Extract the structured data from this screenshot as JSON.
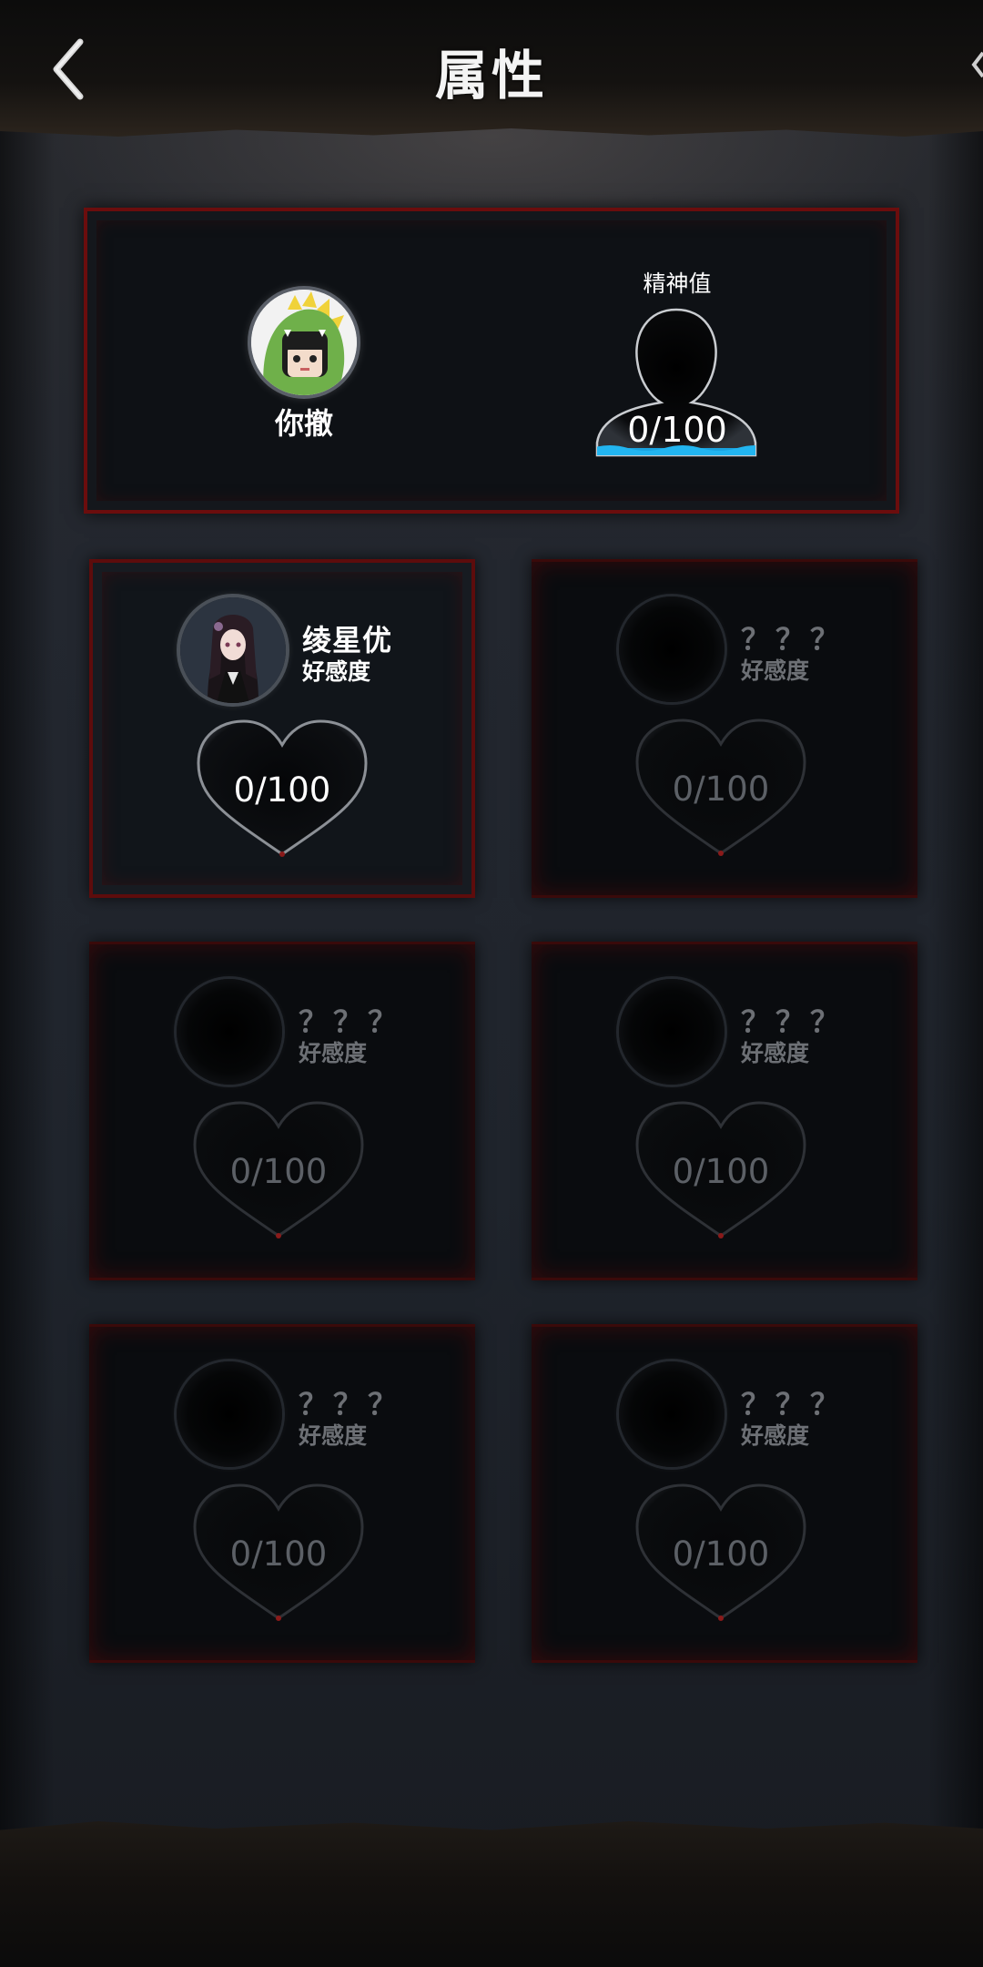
{
  "header": {
    "title": "属性",
    "back_icon": "chevron-left-icon"
  },
  "player": {
    "name": "你撤",
    "avatar_icon": "dinosaur-hood-avatar",
    "sanity": {
      "label": "精神值",
      "value_text": "0/100",
      "value": 0,
      "max": 100,
      "icon": "person-silhouette-icon"
    }
  },
  "characters": [
    {
      "name": "绫星优",
      "affinity_label": "好感度",
      "value_text": "0/100",
      "value": 0,
      "max": 100,
      "unlocked": true,
      "portrait_icon": "girl-portrait"
    },
    {
      "name": "？？？",
      "affinity_label": "好感度",
      "value_text": "0/100",
      "value": 0,
      "max": 100,
      "unlocked": false,
      "portrait_icon": "empty-portrait"
    },
    {
      "name": "？？？",
      "affinity_label": "好感度",
      "value_text": "0/100",
      "value": 0,
      "max": 100,
      "unlocked": false,
      "portrait_icon": "empty-portrait"
    },
    {
      "name": "？？？",
      "affinity_label": "好感度",
      "value_text": "0/100",
      "value": 0,
      "max": 100,
      "unlocked": false,
      "portrait_icon": "empty-portrait"
    },
    {
      "name": "？？？",
      "affinity_label": "好感度",
      "value_text": "0/100",
      "value": 0,
      "max": 100,
      "unlocked": false,
      "portrait_icon": "empty-portrait"
    },
    {
      "name": "？？？",
      "affinity_label": "好感度",
      "value_text": "0/100",
      "value": 0,
      "max": 100,
      "unlocked": false,
      "portrait_icon": "empty-portrait"
    }
  ],
  "colors": {
    "frame_red": "#6b0d0d",
    "sanity_water": "#1aa3e0",
    "locked_text": "#6d7075"
  }
}
